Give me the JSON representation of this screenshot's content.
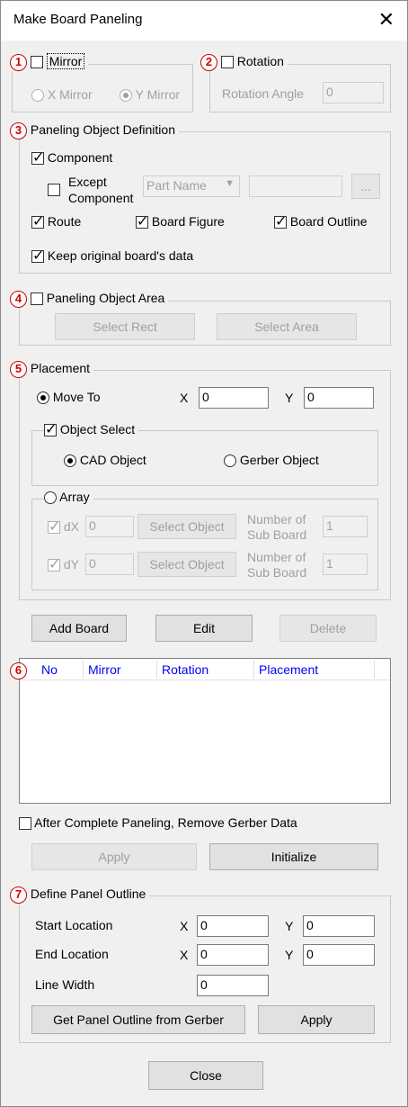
{
  "window": {
    "title": "Make Board Paneling",
    "close_icon": "close-icon"
  },
  "mirror": {
    "marker": "1",
    "label": "Mirror",
    "checked": false,
    "x_mirror": "X Mirror",
    "y_mirror": "Y Mirror"
  },
  "rotation": {
    "marker": "2",
    "label": "Rotation",
    "checked": false,
    "angle_label": "Rotation Angle",
    "angle_value": "0"
  },
  "definition": {
    "marker": "3",
    "title": "Paneling Object Definition",
    "component": "Component",
    "except_line1": "Except",
    "except_line2": "Component",
    "part_select": "Part Name",
    "browse": "...",
    "route": "Route",
    "board_figure": "Board Figure",
    "board_outline": "Board Outline",
    "keep": "Keep original board's data"
  },
  "area": {
    "marker": "4",
    "label": "Paneling Object Area",
    "select_rect": "Select Rect",
    "select_area": "Select Area"
  },
  "placement": {
    "marker": "5",
    "title": "Placement",
    "move_to": "Move To",
    "x_label": "X",
    "x_value": "0",
    "y_label": "Y",
    "y_value": "0",
    "object_select": "Object Select",
    "cad_object": "CAD Object",
    "gerber_object": "Gerber Object",
    "array": "Array",
    "dx_label": "dX",
    "dx_value": "0",
    "dy_label": "dY",
    "dy_value": "0",
    "select_object": "Select Object",
    "sub_line1": "Number of",
    "sub_line2": "Sub Board",
    "sub_x_value": "1",
    "sub_y_value": "1"
  },
  "actions": {
    "add_board": "Add Board",
    "edit": "Edit",
    "delete": "Delete"
  },
  "list": {
    "marker": "6",
    "columns": [
      "No",
      "Mirror",
      "Rotation",
      "Placement"
    ]
  },
  "remove_gerber": "After Complete Paneling, Remove Gerber Data",
  "apply_init": {
    "apply": "Apply",
    "initialize": "Initialize"
  },
  "outline": {
    "marker": "7",
    "title": "Define Panel Outline",
    "start": "Start Location",
    "end": "End Location",
    "width": "Line Width",
    "x_label": "X",
    "y_label": "Y",
    "start_x": "0",
    "start_y": "0",
    "end_x": "0",
    "end_y": "0",
    "width_value": "0",
    "get_outline": "Get Panel Outline from Gerber",
    "apply": "Apply"
  },
  "close_button": "Close",
  "colors": {
    "marker": "#d00000",
    "column_header": "#0000ff",
    "dialog_bg": "#f0f0f0"
  }
}
